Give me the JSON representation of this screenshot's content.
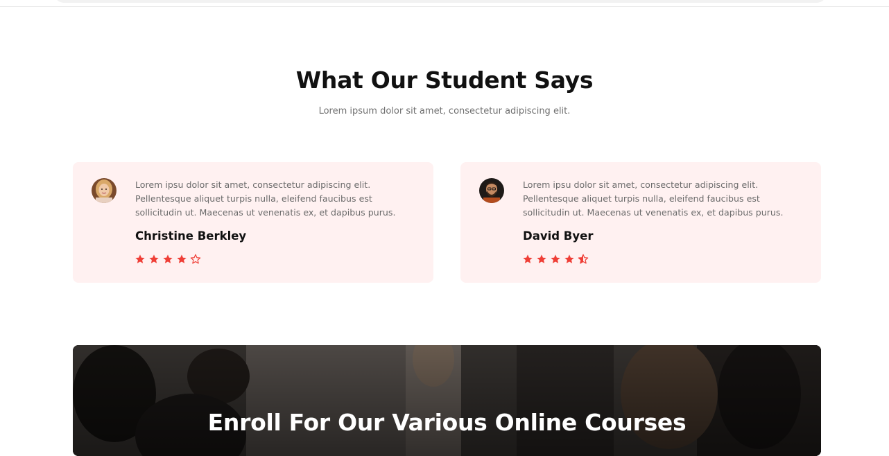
{
  "testimonials_section": {
    "title": "What Our Student Says",
    "subtitle": "Lorem ipsum dolor sit amet, consectetur adipiscing elit."
  },
  "testimonials": [
    {
      "quote": "Lorem ipsu dolor sit amet, consectetur adipiscing elit. Pellentesque aliquet turpis nulla, eleifend faucibus est sollicitudin ut. Maecenas ut venenatis ex, et dapibus purus.",
      "name": "Christine Berkley",
      "rating": 4,
      "avatar": "female-student-avatar"
    },
    {
      "quote": "Lorem ipsu dolor sit amet, consectetur adipiscing elit. Pellentesque aliquet turpis nulla, eleifend faucibus est sollicitudin ut. Maecenas ut venenatis ex, et dapibus purus.",
      "name": "David Byer",
      "rating": 4.5,
      "avatar": "male-student-avatar"
    }
  ],
  "enroll_banner": {
    "title": "Enroll For Our Various Online Courses"
  },
  "colors": {
    "card_background": "#fff1f1",
    "star": "#ef3e36",
    "title": "#111111",
    "body_text": "#6b6b6b"
  }
}
